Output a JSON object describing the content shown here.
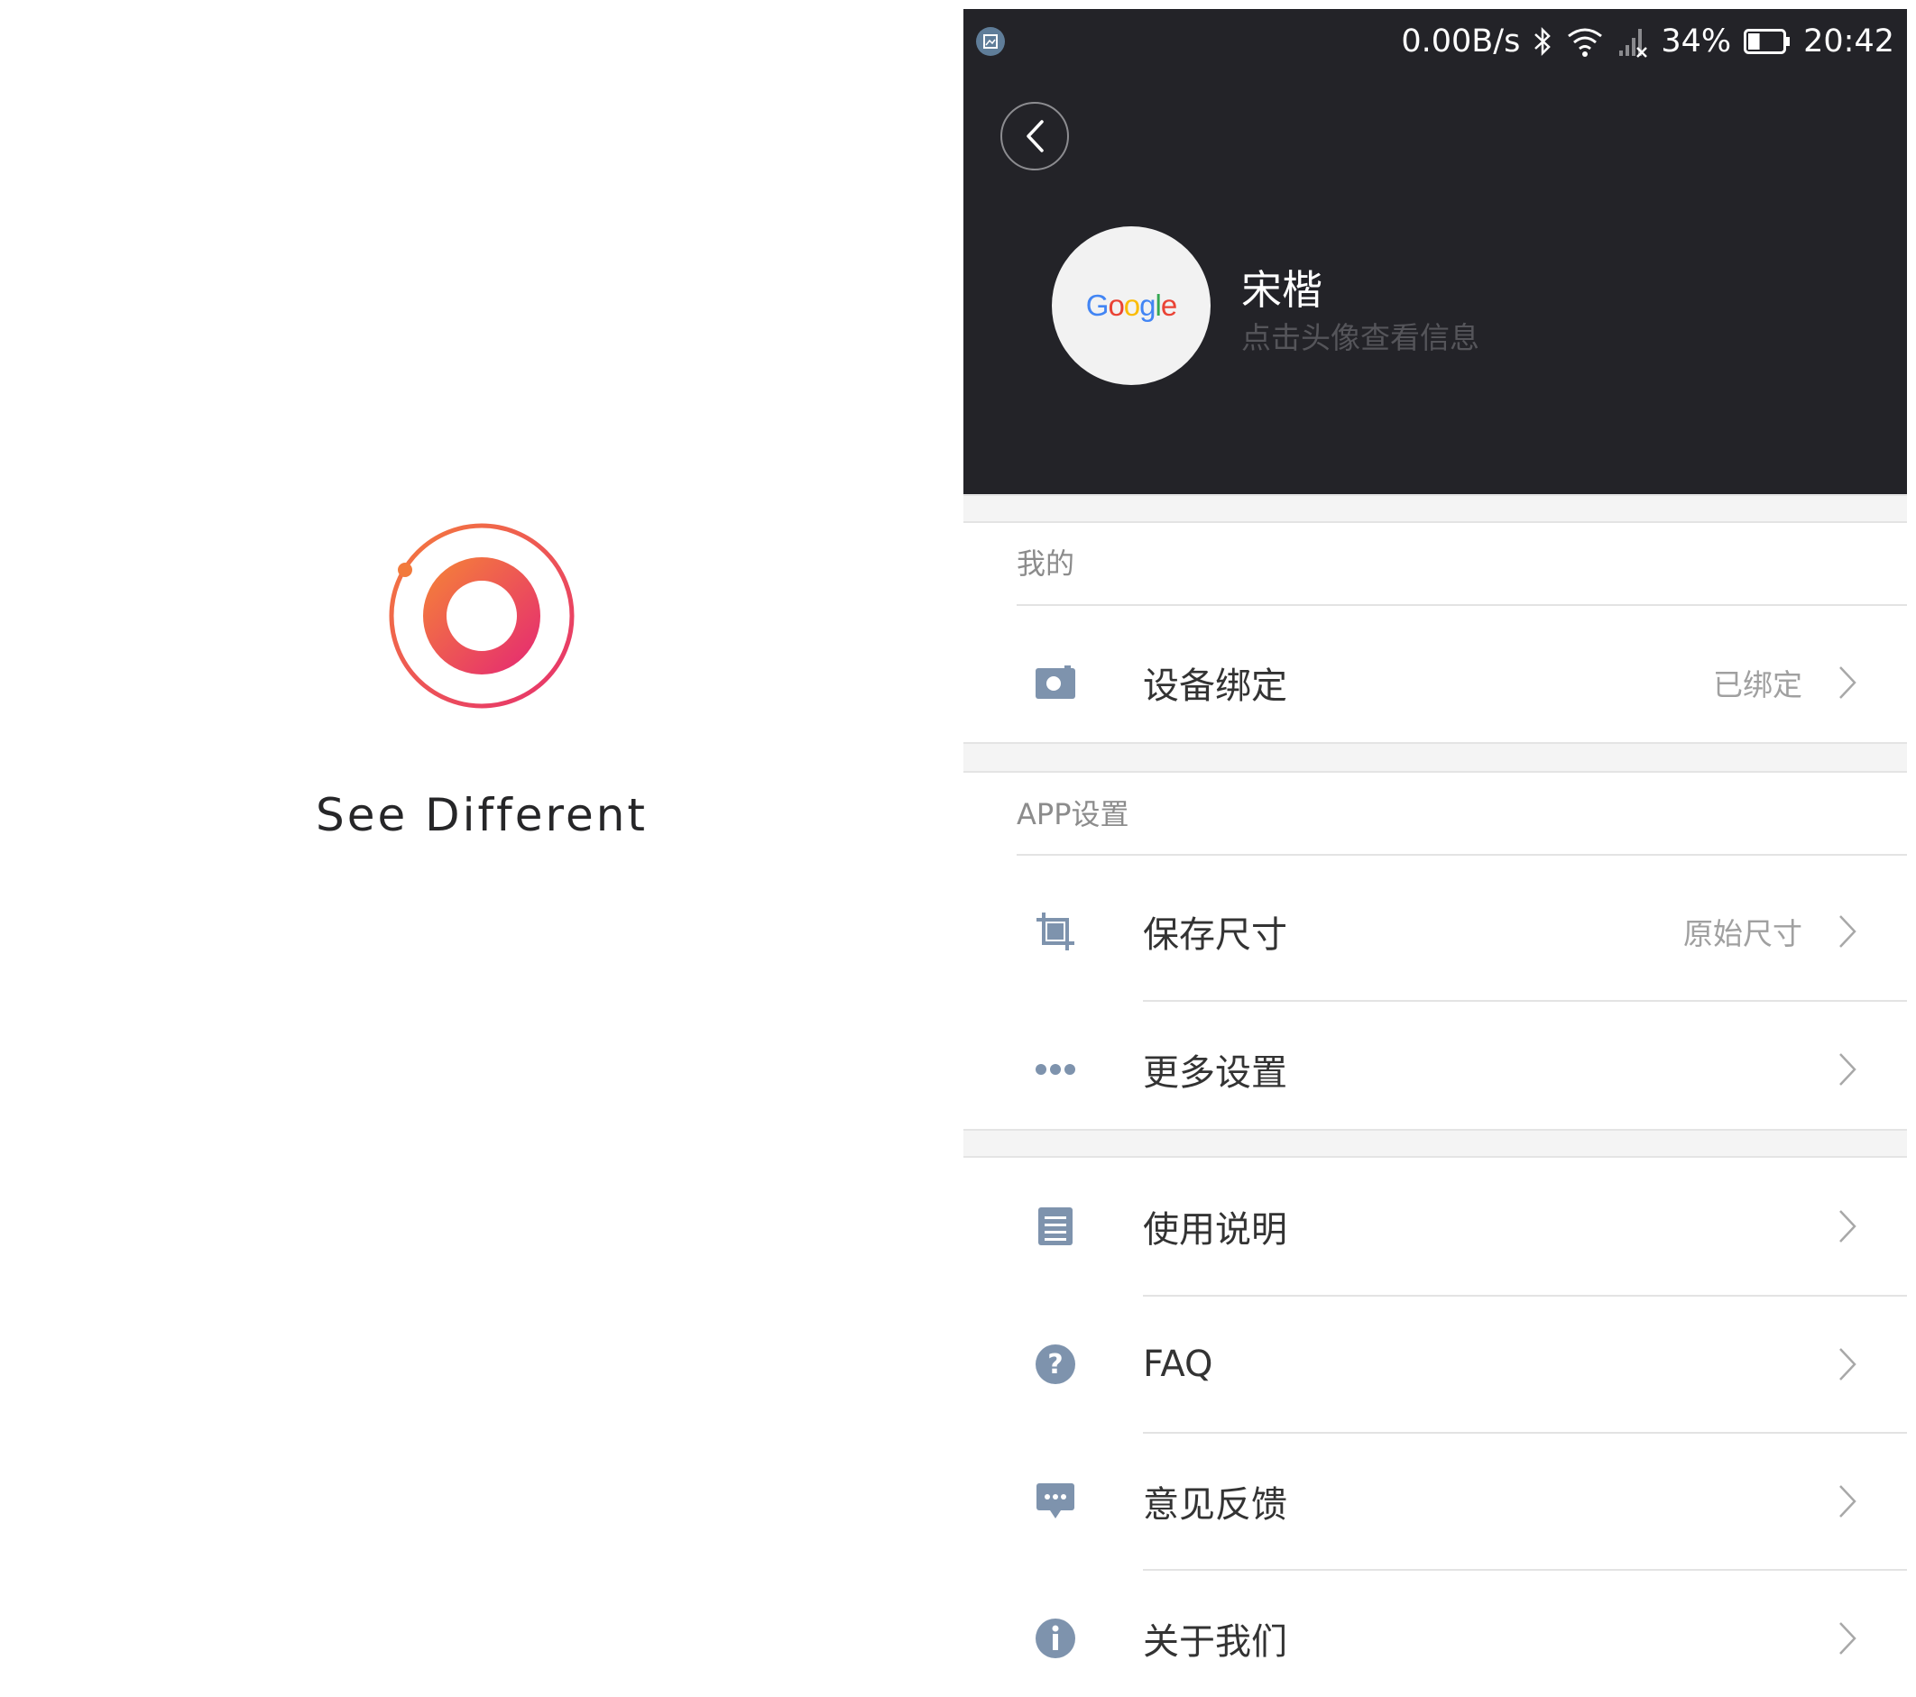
{
  "splash": {
    "tagline": "See Different",
    "logo_colors": {
      "orange": "#f27a3c",
      "pink": "#e8336b"
    }
  },
  "status_bar": {
    "net_speed": "0.00B/s",
    "battery_percent": "34%",
    "battery_level": 0.34,
    "time": "20:42",
    "icons": [
      "screenshot-icon",
      "bluetooth-icon",
      "wifi-icon",
      "signal-icon",
      "battery-icon"
    ]
  },
  "profile": {
    "avatar_word": "Google",
    "name": "宋楷",
    "hint": "点击头像查看信息"
  },
  "sections": {
    "mine": {
      "title": "我的",
      "rows": [
        {
          "label": "设备绑定",
          "value": "已绑定",
          "icon": "camera-icon"
        }
      ]
    },
    "app_settings": {
      "title": "APP设置",
      "rows": [
        {
          "label": "保存尺寸",
          "value": "原始尺寸",
          "icon": "crop-icon"
        },
        {
          "label": "更多设置",
          "value": "",
          "icon": "more-dots-icon"
        }
      ]
    },
    "other": {
      "rows": [
        {
          "label": "使用说明",
          "icon": "document-icon"
        },
        {
          "label": "FAQ",
          "icon": "question-icon"
        },
        {
          "label": "意见反馈",
          "icon": "feedback-icon"
        },
        {
          "label": "关于我们",
          "icon": "info-icon"
        }
      ]
    }
  },
  "colors": {
    "header_bg": "#232328",
    "icon_color": "#7e93ad",
    "divider": "#e3e3e3",
    "value_text": "#a0a0a0"
  }
}
